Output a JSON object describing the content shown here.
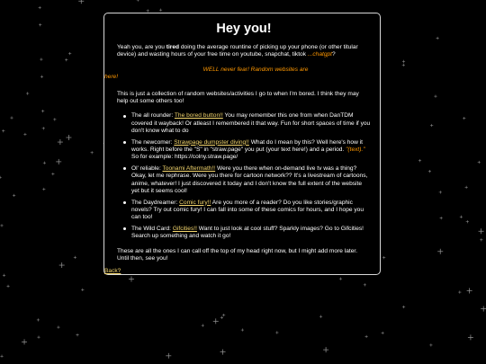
{
  "title": "Hey you!",
  "intro": {
    "before": "Yeah you, are you ",
    "bold": "tired",
    "after": " doing the average rountine of picking up your phone (or other titular device) and wasting hours of your free time on youtube, snapchat, tiktok ",
    "ellipsis": "...chatgpt",
    "tail": "?"
  },
  "warning": {
    "line1": "WELL never fear! Random websites are",
    "line2": "here!"
  },
  "description": "This is just a collection of random websites/activities I go to when I'm bored. I think they may help out some others too!",
  "items": [
    {
      "prefix": "The all rounder: ",
      "link": "The bored button!!",
      "text": " You may remember this one from when DanTDM covered it wayback! Or atleast I remembered it that way. Fun for short spaces of time if you don't know what to do"
    },
    {
      "prefix": "The newcomer: ",
      "link": "Strawpage dumpster diving!!",
      "text": " What do I mean by this? Well here's how it works. Right before the \"S\" in \"straw.page\" you put (your text here!) and a period. ",
      "accent": "\"(text).\"",
      "text2": " So for example: https://colny.straw.page/"
    },
    {
      "prefix": "Ol' reliable: ",
      "link": "Toonami Aftermath!!",
      "text": " Were you there when on-demand live tv was a thing? Okay, let me rephrase. Were you there for cartoon network?? It's a livestream of cartoons, anime, whatever! I just discovered it today and I don't know the full extent of the website yet but it seems cool!"
    },
    {
      "prefix": "The Daydreamer: ",
      "link": "Comic fury!!",
      "text": " Are you more of a reader? Do you like stories/graphic novels? Try out comic fury! I can fall into some of these comics for hours, and I hope you can too!"
    },
    {
      "prefix": "The Wild Card: ",
      "link": "Gifcities!!",
      "text": " Want to just look at cool stuff? Sparkly images? Go to Gifcities! Search up something and watch it go!"
    }
  ],
  "closing": "These are all the ones I can call off the top of my head right now, but I might add more later. Until then, see you!",
  "back_link": "Back?",
  "colors": {
    "background": "#000000",
    "text": "#ffffff",
    "accent_orange": "#ff9800",
    "link_yellow": "#f5d76e",
    "panel_border": "#d8d8d8"
  }
}
